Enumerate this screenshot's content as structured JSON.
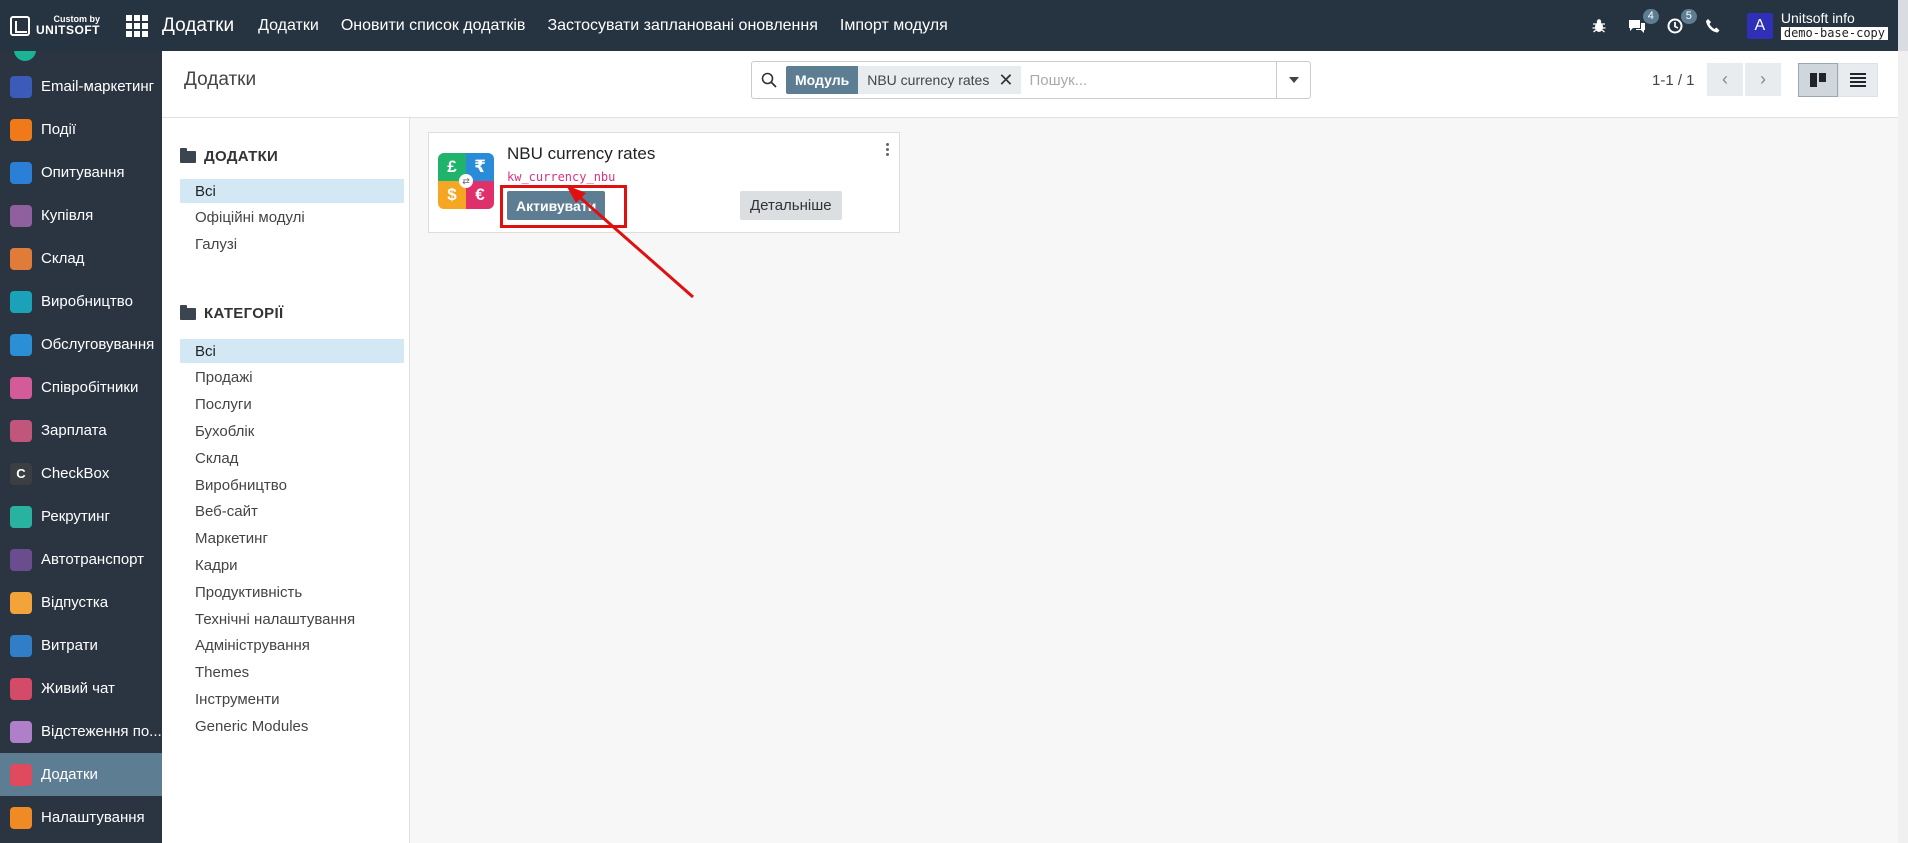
{
  "topbar": {
    "logo_small": "Custom by",
    "logo_big": "UNITSOFT",
    "app_name": "Додатки",
    "menu": [
      "Додатки",
      "Оновити список додатків",
      "Застосувати заплановані оновлення",
      "Імпорт модуля"
    ],
    "messages_count": "4",
    "activities_count": "5",
    "avatar_letter": "A",
    "user_name": "Unitsoft info",
    "database": "demo-base-copy"
  },
  "sidebar": {
    "items": [
      {
        "label": "Email-маркетинг",
        "icon": "email-marketing-icon",
        "color": "#3c5ab8"
      },
      {
        "label": "Події",
        "icon": "events-icon",
        "color": "#f07a1a"
      },
      {
        "label": "Опитування",
        "icon": "survey-icon",
        "color": "#2a7fd6"
      },
      {
        "label": "Купівля",
        "icon": "purchase-icon",
        "color": "#8f5f9e"
      },
      {
        "label": "Склад",
        "icon": "inventory-icon",
        "color": "#e07b39"
      },
      {
        "label": "Виробництво",
        "icon": "manufacturing-icon",
        "color": "#1aa3b8"
      },
      {
        "label": "Обслуговування",
        "icon": "maintenance-icon",
        "color": "#2b8fd6"
      },
      {
        "label": "Співробітники",
        "icon": "employees-icon",
        "color": "#d45b9a"
      },
      {
        "label": "Зарплата",
        "icon": "payroll-icon",
        "color": "#c0567a"
      },
      {
        "label": "CheckBox",
        "icon": "checkbox-app-icon",
        "color": "#3b3f44"
      },
      {
        "label": "Рекрутинг",
        "icon": "recruitment-icon",
        "color": "#2ab2a0"
      },
      {
        "label": "Автотранспорт",
        "icon": "fleet-icon",
        "color": "#6b4d8f"
      },
      {
        "label": "Відпустка",
        "icon": "time-off-icon",
        "color": "#f2a33a"
      },
      {
        "label": "Витрати",
        "icon": "expenses-icon",
        "color": "#2f7ec7"
      },
      {
        "label": "Живий чат",
        "icon": "live-chat-icon",
        "color": "#d44b6a"
      },
      {
        "label": "Відстеження по...",
        "icon": "tracking-icon",
        "color": "#b07fc9"
      },
      {
        "label": "Додатки",
        "icon": "apps-icon",
        "color": "#e04a5f",
        "active": true
      },
      {
        "label": "Налаштування",
        "icon": "settings-icon",
        "color": "#f08a24"
      }
    ]
  },
  "control": {
    "breadcrumb": "Додатки",
    "facet_label": "Модуль",
    "facet_value": "NBU currency rates",
    "search_placeholder": "Пошук...",
    "pager": "1-1 / 1"
  },
  "searchpanel": {
    "section1_title": "ДОДАТКИ",
    "section1_items": [
      "Всі",
      "Офіційні модулі",
      "Галузі"
    ],
    "section2_title": "КАТЕГОРІЇ",
    "section2_items": [
      "Всі",
      "Продажі",
      "Послуги",
      "Бухоблік",
      "Склад",
      "Виробництво",
      "Веб-сайт",
      "Маркетинг",
      "Кадри",
      "Продуктивність",
      "Технічні налаштування",
      "Адміністрування",
      "Themes",
      "Інструменти",
      "Generic Modules"
    ]
  },
  "module_card": {
    "title": "NBU currency rates",
    "technical_name": "kw_currency_nbu",
    "activate_label": "Активувати",
    "details_label": "Детальніше",
    "icon_symbols": [
      "£",
      "₹",
      "$",
      "€"
    ],
    "icon_colors": [
      "#1fb36b",
      "#2a8bd8",
      "#f5a623",
      "#e0306b"
    ]
  },
  "annotation": {
    "highlight_color": "#e01010"
  }
}
